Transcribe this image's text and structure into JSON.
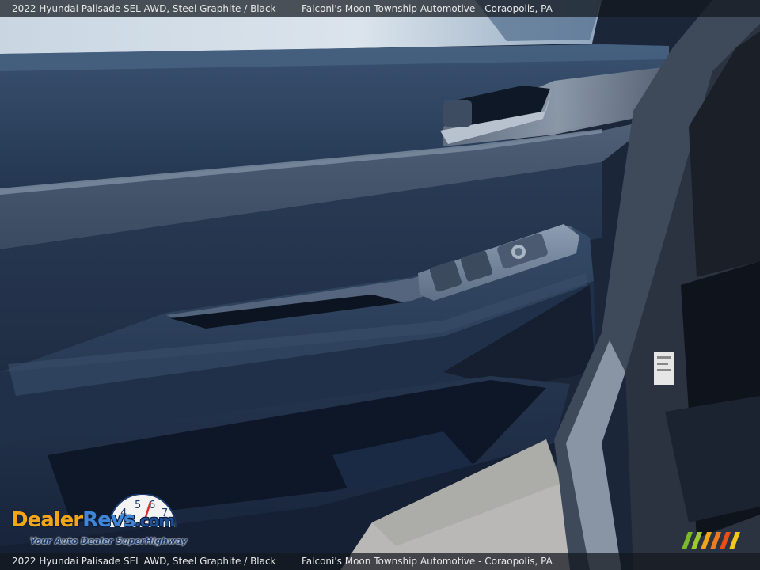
{
  "caption": {
    "left_text": "2022 Hyundai Palisade SEL AWD,  Steel Graphite / Black",
    "right_text": "Falconi's Moon Township Automotive - Coraopolis, PA"
  },
  "watermark": {
    "brand_dealer": "Dealer",
    "brand_revs": "Revs",
    "brand_com": ".com",
    "tagline": "Your Auto Dealer SuperHighway",
    "dial_digits": [
      "4",
      "5",
      "6",
      "7"
    ]
  },
  "photo": {
    "subject": "door-panel-interior",
    "colors": {
      "door_panel": "#2b3a50",
      "trim_silver": "#8a97a8",
      "pavement": "#b9b8b6",
      "stripe_colors": [
        "#7ab928",
        "#9ccb2f",
        "#f2a516",
        "#ee7b20",
        "#e94f1d",
        "#f2c81c"
      ]
    }
  }
}
